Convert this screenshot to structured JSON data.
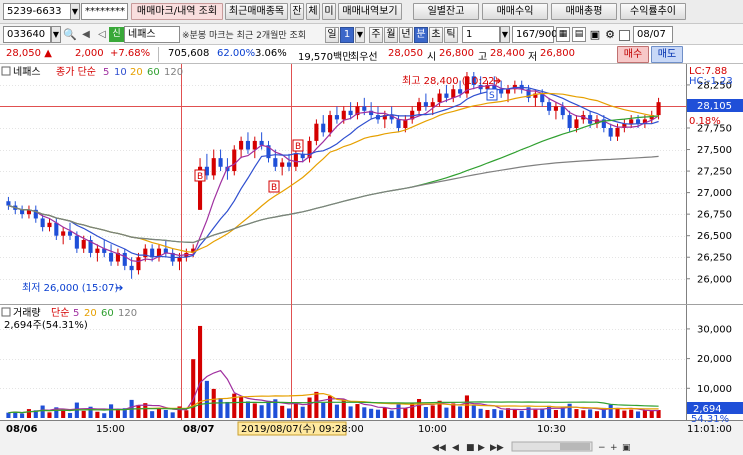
{
  "toolbar": {
    "account": "5239-6633",
    "password": "********",
    "tabs": [
      "매매마크/내역 조회",
      "최근매매종목",
      "잔",
      "체",
      "미",
      "매매내역보기"
    ],
    "right_buttons": [
      "일별잔고",
      "매매수익",
      "매매총평",
      "수익률추이"
    ]
  },
  "stock": {
    "code": "033640",
    "badge": "신",
    "name": "네패스",
    "notice": "분봉 마크는 최근 2개월만 조회",
    "period_buttons": [
      "일",
      "1",
      "주",
      "월",
      "년",
      "분",
      "초",
      "틱"
    ],
    "interval": "1",
    "count": "167/900",
    "date": "08/07"
  },
  "quote": {
    "price": "28,050",
    "change": "2,000",
    "change_pct": "+7.68%",
    "volume": "705,608",
    "ratio": "62.00%",
    "turnover": "3.06%",
    "amount": "19,570백만",
    "priority_label": "최우선",
    "priority": "28,050",
    "open_label": "시",
    "open": "26,800",
    "high_label": "고",
    "high": "28,400",
    "low_label": "저",
    "low": "26,800",
    "buy": "매수",
    "sell": "매도"
  },
  "price_panel": {
    "legend": {
      "name": "네패스",
      "type": "종가 단순",
      "ma": [
        "5",
        "10",
        "20",
        "60",
        "120"
      ]
    },
    "lc": "LC:7.88",
    "hc": "HC:-1.23",
    "current_label": "28,105",
    "pct_label": "0.18%",
    "high_note": "최고 28,400 (10:22)",
    "low_note": "최저 26,000 (15:07)",
    "marker_b": "B",
    "marker_s": "S",
    "y_ticks": [
      "28,250",
      "28,000",
      "27,750",
      "27,500",
      "27,250",
      "27,000",
      "26,750",
      "26,500",
      "26,250",
      "26,000"
    ]
  },
  "volume_panel": {
    "legend": {
      "name": "거래량",
      "type": "단순",
      "ma": [
        "5",
        "20",
        "60",
        "120"
      ]
    },
    "info": "2,694주(54.31%)",
    "current_label": "2,694",
    "pct_label": "54.31%",
    "y_ticks": [
      "30,000",
      "20,000",
      "10,000"
    ]
  },
  "x_axis": {
    "labels": [
      "08/06",
      "15:00",
      "08/07",
      "10:00",
      "10:30"
    ],
    "cursor": "2019/08/07(수) 09:28:00",
    "time": "11:01:00"
  },
  "colors": {
    "up": "#d40000",
    "down": "#1f4fd8",
    "ma5": "#a030a0",
    "ma10": "#3050d0",
    "ma20": "#e6a000",
    "ma60": "#30a030",
    "ma120": "#808080"
  },
  "chart_data": {
    "type": "candlestick",
    "price_axis": {
      "min": 25800,
      "max": 28400
    },
    "volume_axis": {
      "min": 0,
      "max": 33000
    },
    "points": [
      {
        "o": 26900,
        "h": 26950,
        "l": 26800,
        "c": 26850,
        "v": 1800
      },
      {
        "o": 26850,
        "h": 26900,
        "l": 26750,
        "c": 26800,
        "v": 2200
      },
      {
        "o": 26800,
        "h": 26850,
        "l": 26700,
        "c": 26750,
        "v": 1500
      },
      {
        "o": 26750,
        "h": 26850,
        "l": 26700,
        "c": 26800,
        "v": 3000
      },
      {
        "o": 26800,
        "h": 26850,
        "l": 26650,
        "c": 26700,
        "v": 2600
      },
      {
        "o": 26700,
        "h": 26750,
        "l": 26550,
        "c": 26600,
        "v": 4200
      },
      {
        "o": 26600,
        "h": 26700,
        "l": 26550,
        "c": 26650,
        "v": 1900
      },
      {
        "o": 26650,
        "h": 26700,
        "l": 26450,
        "c": 26500,
        "v": 3600
      },
      {
        "o": 26500,
        "h": 26600,
        "l": 26400,
        "c": 26550,
        "v": 2800
      },
      {
        "o": 26550,
        "h": 26650,
        "l": 26450,
        "c": 26500,
        "v": 1700
      },
      {
        "o": 26500,
        "h": 26550,
        "l": 26300,
        "c": 26350,
        "v": 5200
      },
      {
        "o": 26350,
        "h": 26500,
        "l": 26300,
        "c": 26450,
        "v": 2400
      },
      {
        "o": 26450,
        "h": 26500,
        "l": 26250,
        "c": 26300,
        "v": 3800
      },
      {
        "o": 26300,
        "h": 26400,
        "l": 26200,
        "c": 26350,
        "v": 2100
      },
      {
        "o": 26350,
        "h": 26450,
        "l": 26250,
        "c": 26300,
        "v": 1600
      },
      {
        "o": 26300,
        "h": 26400,
        "l": 26150,
        "c": 26200,
        "v": 4600
      },
      {
        "o": 26200,
        "h": 26350,
        "l": 26150,
        "c": 26300,
        "v": 2900
      },
      {
        "o": 26300,
        "h": 26350,
        "l": 26100,
        "c": 26150,
        "v": 3300
      },
      {
        "o": 26150,
        "h": 26250,
        "l": 26000,
        "c": 26100,
        "v": 6100
      },
      {
        "o": 26100,
        "h": 26300,
        "l": 26050,
        "c": 26250,
        "v": 4400
      },
      {
        "o": 26250,
        "h": 26400,
        "l": 26200,
        "c": 26350,
        "v": 5000
      },
      {
        "o": 26350,
        "h": 26400,
        "l": 26200,
        "c": 26250,
        "v": 2300
      },
      {
        "o": 26250,
        "h": 26400,
        "l": 26200,
        "c": 26350,
        "v": 3100
      },
      {
        "o": 26350,
        "h": 26450,
        "l": 26250,
        "c": 26300,
        "v": 2700
      },
      {
        "o": 26300,
        "h": 26350,
        "l": 26150,
        "c": 26200,
        "v": 1900
      },
      {
        "o": 26200,
        "h": 26300,
        "l": 26100,
        "c": 26250,
        "v": 3900
      },
      {
        "o": 26250,
        "h": 26350,
        "l": 26200,
        "c": 26300,
        "v": 2600
      },
      {
        "o": 26300,
        "h": 26400,
        "l": 26250,
        "c": 26350,
        "v": 19800
      },
      {
        "o": 26800,
        "h": 27400,
        "l": 26800,
        "c": 27300,
        "v": 31000
      },
      {
        "o": 27300,
        "h": 27450,
        "l": 27150,
        "c": 27200,
        "v": 12500
      },
      {
        "o": 27200,
        "h": 27500,
        "l": 27150,
        "c": 27400,
        "v": 9800
      },
      {
        "o": 27400,
        "h": 27500,
        "l": 27250,
        "c": 27300,
        "v": 6700
      },
      {
        "o": 27300,
        "h": 27400,
        "l": 27150,
        "c": 27250,
        "v": 5400
      },
      {
        "o": 27250,
        "h": 27550,
        "l": 27200,
        "c": 27500,
        "v": 8200
      },
      {
        "o": 27500,
        "h": 27650,
        "l": 27400,
        "c": 27600,
        "v": 7100
      },
      {
        "o": 27600,
        "h": 27700,
        "l": 27450,
        "c": 27500,
        "v": 5600
      },
      {
        "o": 27500,
        "h": 27650,
        "l": 27400,
        "c": 27600,
        "v": 4900
      },
      {
        "o": 27600,
        "h": 27700,
        "l": 27500,
        "c": 27550,
        "v": 4300
      },
      {
        "o": 27550,
        "h": 27600,
        "l": 27350,
        "c": 27400,
        "v": 5800
      },
      {
        "o": 27400,
        "h": 27500,
        "l": 27250,
        "c": 27300,
        "v": 6300
      },
      {
        "o": 27300,
        "h": 27400,
        "l": 27200,
        "c": 27350,
        "v": 4100
      },
      {
        "o": 27350,
        "h": 27450,
        "l": 27250,
        "c": 27300,
        "v": 3200
      },
      {
        "o": 27300,
        "h": 27500,
        "l": 27250,
        "c": 27450,
        "v": 5200
      },
      {
        "o": 27450,
        "h": 27550,
        "l": 27350,
        "c": 27400,
        "v": 3800
      },
      {
        "o": 27400,
        "h": 27650,
        "l": 27350,
        "c": 27600,
        "v": 6900
      },
      {
        "o": 27600,
        "h": 27850,
        "l": 27550,
        "c": 27800,
        "v": 8800
      },
      {
        "o": 27800,
        "h": 27900,
        "l": 27650,
        "c": 27700,
        "v": 5100
      },
      {
        "o": 27700,
        "h": 27950,
        "l": 27650,
        "c": 27900,
        "v": 7400
      },
      {
        "o": 27900,
        "h": 28000,
        "l": 27800,
        "c": 27850,
        "v": 4500
      },
      {
        "o": 27850,
        "h": 28000,
        "l": 27800,
        "c": 27950,
        "v": 6200
      },
      {
        "o": 27950,
        "h": 28050,
        "l": 27850,
        "c": 27900,
        "v": 3900
      },
      {
        "o": 27900,
        "h": 28050,
        "l": 27850,
        "c": 28000,
        "v": 4700
      },
      {
        "o": 28000,
        "h": 28100,
        "l": 27900,
        "c": 27950,
        "v": 3600
      },
      {
        "o": 27950,
        "h": 28050,
        "l": 27850,
        "c": 27900,
        "v": 3100
      },
      {
        "o": 27900,
        "h": 28000,
        "l": 27800,
        "c": 27850,
        "v": 2800
      },
      {
        "o": 27850,
        "h": 27950,
        "l": 27750,
        "c": 27900,
        "v": 3400
      },
      {
        "o": 27900,
        "h": 28000,
        "l": 27800,
        "c": 27850,
        "v": 2500
      },
      {
        "o": 27850,
        "h": 27900,
        "l": 27700,
        "c": 27750,
        "v": 4600
      },
      {
        "o": 27750,
        "h": 27900,
        "l": 27700,
        "c": 27850,
        "v": 3300
      },
      {
        "o": 27850,
        "h": 28000,
        "l": 27800,
        "c": 27950,
        "v": 5000
      },
      {
        "o": 27950,
        "h": 28100,
        "l": 27900,
        "c": 28050,
        "v": 6400
      },
      {
        "o": 28050,
        "h": 28150,
        "l": 27950,
        "c": 28000,
        "v": 3700
      },
      {
        "o": 28000,
        "h": 28100,
        "l": 27900,
        "c": 28050,
        "v": 4200
      },
      {
        "o": 28050,
        "h": 28200,
        "l": 28000,
        "c": 28150,
        "v": 5800
      },
      {
        "o": 28150,
        "h": 28250,
        "l": 28050,
        "c": 28100,
        "v": 3500
      },
      {
        "o": 28100,
        "h": 28250,
        "l": 28050,
        "c": 28200,
        "v": 4900
      },
      {
        "o": 28200,
        "h": 28300,
        "l": 28100,
        "c": 28150,
        "v": 3900
      },
      {
        "o": 28150,
        "h": 28400,
        "l": 28100,
        "c": 28350,
        "v": 7600
      },
      {
        "o": 28350,
        "h": 28400,
        "l": 28200,
        "c": 28250,
        "v": 4300
      },
      {
        "o": 28250,
        "h": 28350,
        "l": 28150,
        "c": 28200,
        "v": 3100
      },
      {
        "o": 28200,
        "h": 28300,
        "l": 28100,
        "c": 28250,
        "v": 2700
      },
      {
        "o": 28250,
        "h": 28350,
        "l": 28150,
        "c": 28200,
        "v": 3000
      },
      {
        "o": 28200,
        "h": 28300,
        "l": 28100,
        "c": 28150,
        "v": 2600
      },
      {
        "o": 28150,
        "h": 28250,
        "l": 28050,
        "c": 28200,
        "v": 3300
      },
      {
        "o": 28200,
        "h": 28300,
        "l": 28150,
        "c": 28250,
        "v": 2900
      },
      {
        "o": 28250,
        "h": 28300,
        "l": 28150,
        "c": 28200,
        "v": 2400
      },
      {
        "o": 28200,
        "h": 28250,
        "l": 28050,
        "c": 28100,
        "v": 3600
      },
      {
        "o": 28100,
        "h": 28200,
        "l": 28000,
        "c": 28150,
        "v": 2800
      },
      {
        "o": 28150,
        "h": 28200,
        "l": 28000,
        "c": 28050,
        "v": 3200
      },
      {
        "o": 28050,
        "h": 28100,
        "l": 27900,
        "c": 27950,
        "v": 4100
      },
      {
        "o": 27950,
        "h": 28050,
        "l": 27850,
        "c": 28000,
        "v": 2700
      },
      {
        "o": 28000,
        "h": 28050,
        "l": 27850,
        "c": 27900,
        "v": 3500
      },
      {
        "o": 27900,
        "h": 27950,
        "l": 27700,
        "c": 27750,
        "v": 4800
      },
      {
        "o": 27750,
        "h": 27900,
        "l": 27700,
        "c": 27850,
        "v": 3000
      },
      {
        "o": 27850,
        "h": 27950,
        "l": 27800,
        "c": 27900,
        "v": 2600
      },
      {
        "o": 27900,
        "h": 27950,
        "l": 27750,
        "c": 27800,
        "v": 2900
      },
      {
        "o": 27800,
        "h": 27900,
        "l": 27750,
        "c": 27850,
        "v": 2300
      },
      {
        "o": 27850,
        "h": 27900,
        "l": 27700,
        "c": 27750,
        "v": 3400
      },
      {
        "o": 27750,
        "h": 27800,
        "l": 27600,
        "c": 27650,
        "v": 4500
      },
      {
        "o": 27650,
        "h": 27800,
        "l": 27600,
        "c": 27750,
        "v": 3100
      },
      {
        "o": 27750,
        "h": 27850,
        "l": 27700,
        "c": 27800,
        "v": 2500
      },
      {
        "o": 27800,
        "h": 27900,
        "l": 27750,
        "c": 27850,
        "v": 2800
      },
      {
        "o": 27850,
        "h": 27900,
        "l": 27750,
        "c": 27800,
        "v": 2200
      },
      {
        "o": 27800,
        "h": 27900,
        "l": 27750,
        "c": 27850,
        "v": 2600
      },
      {
        "o": 27850,
        "h": 27950,
        "l": 27800,
        "c": 27900,
        "v": 2400
      },
      {
        "o": 27900,
        "h": 28100,
        "l": 27850,
        "c": 28050,
        "v": 2694
      }
    ]
  }
}
